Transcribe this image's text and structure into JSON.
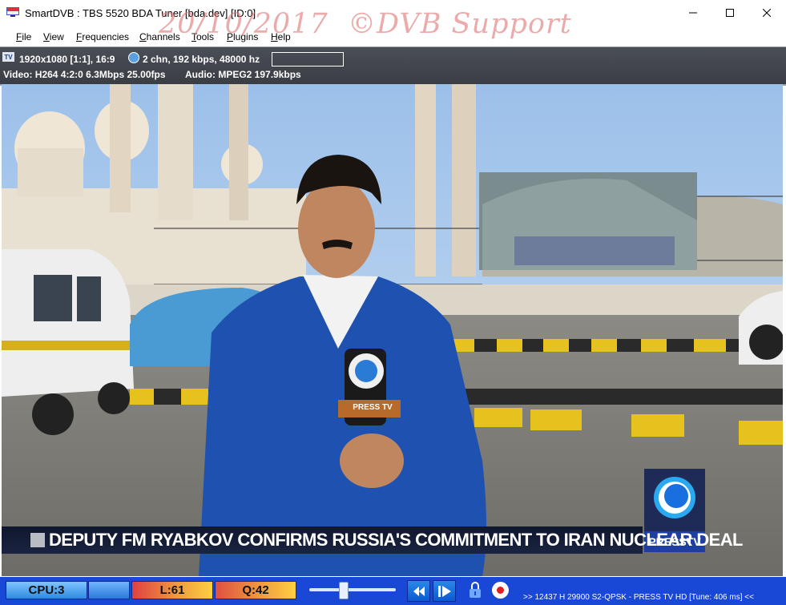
{
  "window": {
    "title": "SmartDVB : TBS 5520 BDA Tuner [bda.dev]  [ID:0]",
    "watermark": "20/10/2017  ©DVB Support"
  },
  "menu": [
    "File",
    "View",
    "Frequencies",
    "Channels",
    "Tools",
    "Plugins",
    "Help"
  ],
  "info": {
    "tv_badge": "TV",
    "resolution": "1920x1080 [1:1], 16:9",
    "audio_channels": "2 chn, 192 kbps, 48000 hz",
    "video": "Video: H264  4:2:0  6.3Mbps  25.00fps",
    "audio": "Audio: MPEG2  197.9kbps"
  },
  "video": {
    "ticker": "DEPUTY FM RYABKOV CONFIRMS RUSSIA'S COMMITMENT TO IRAN NUCLEAR DEAL",
    "mic_flag": "PRESS TV",
    "logo_text": "PRESSTV"
  },
  "status": {
    "cpu": "CPU:3",
    "level": "L:61",
    "quality": "Q:42",
    "volume_fraction": 0.4,
    "tuning": ">> 12437 H 29900 S2-QPSK - PRESS TV HD [Tune: 406 ms] <<"
  },
  "colors": {
    "statusbar": "#1947d6",
    "infobar": "#40434a",
    "ticker_bg": "#141c34",
    "watermark": "#de7878"
  },
  "icons": [
    "app-icon",
    "minimize-icon",
    "maximize-icon",
    "close-icon",
    "tv-icon",
    "audio-icon",
    "rewind-icon",
    "play-icon",
    "lock-icon",
    "record-icon"
  ]
}
